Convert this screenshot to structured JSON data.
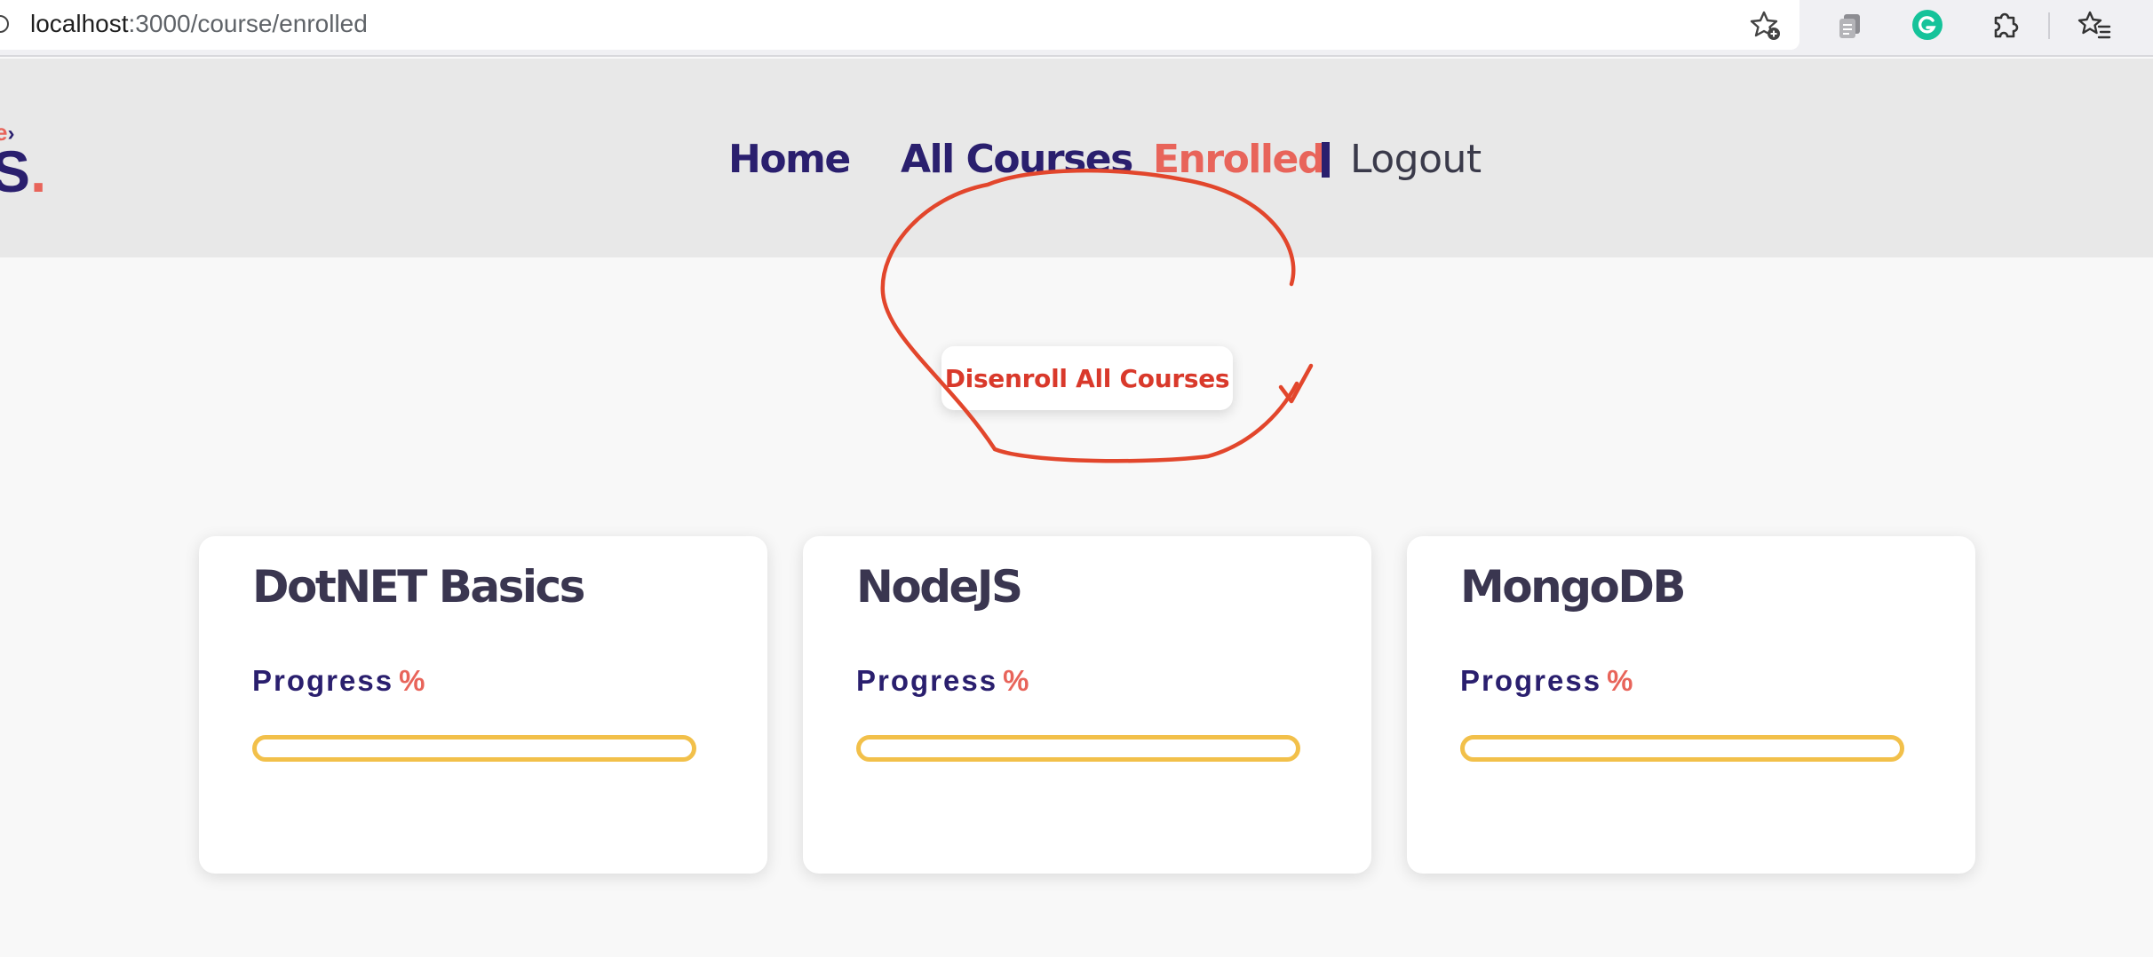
{
  "browser": {
    "url_host": "localhost",
    "url_path": ":3000/course/enrolled",
    "icons": [
      "add-bookmark-icon",
      "extension-icon",
      "grammarly-icon",
      "puzzle-extensions-icon",
      "favorites-icon"
    ]
  },
  "header": {
    "logo_top": "e",
    "logo_chevron": "›",
    "logo_main": "S",
    "logo_dot": ".",
    "nav": [
      {
        "label": "Home",
        "active": false
      },
      {
        "label": "All Courses",
        "active": false
      },
      {
        "label": "Enrolled",
        "active": true
      }
    ],
    "logout_label": "Logout"
  },
  "main": {
    "disenroll_label": "Disenroll All Courses",
    "courses": [
      {
        "title": "DotNET Basics",
        "progress_label": "Progress",
        "progress_unit": "%",
        "progress": 0
      },
      {
        "title": "NodeJS",
        "progress_label": "Progress",
        "progress_unit": "%",
        "progress": 0
      },
      {
        "title": "MongoDB",
        "progress_label": "Progress",
        "progress_unit": "%",
        "progress": 0
      }
    ]
  },
  "colors": {
    "brand_navy": "#2a1f6e",
    "accent_coral": "#e8645a",
    "progress_yellow": "#f2c04a",
    "annotation_red": "#e2462c"
  }
}
